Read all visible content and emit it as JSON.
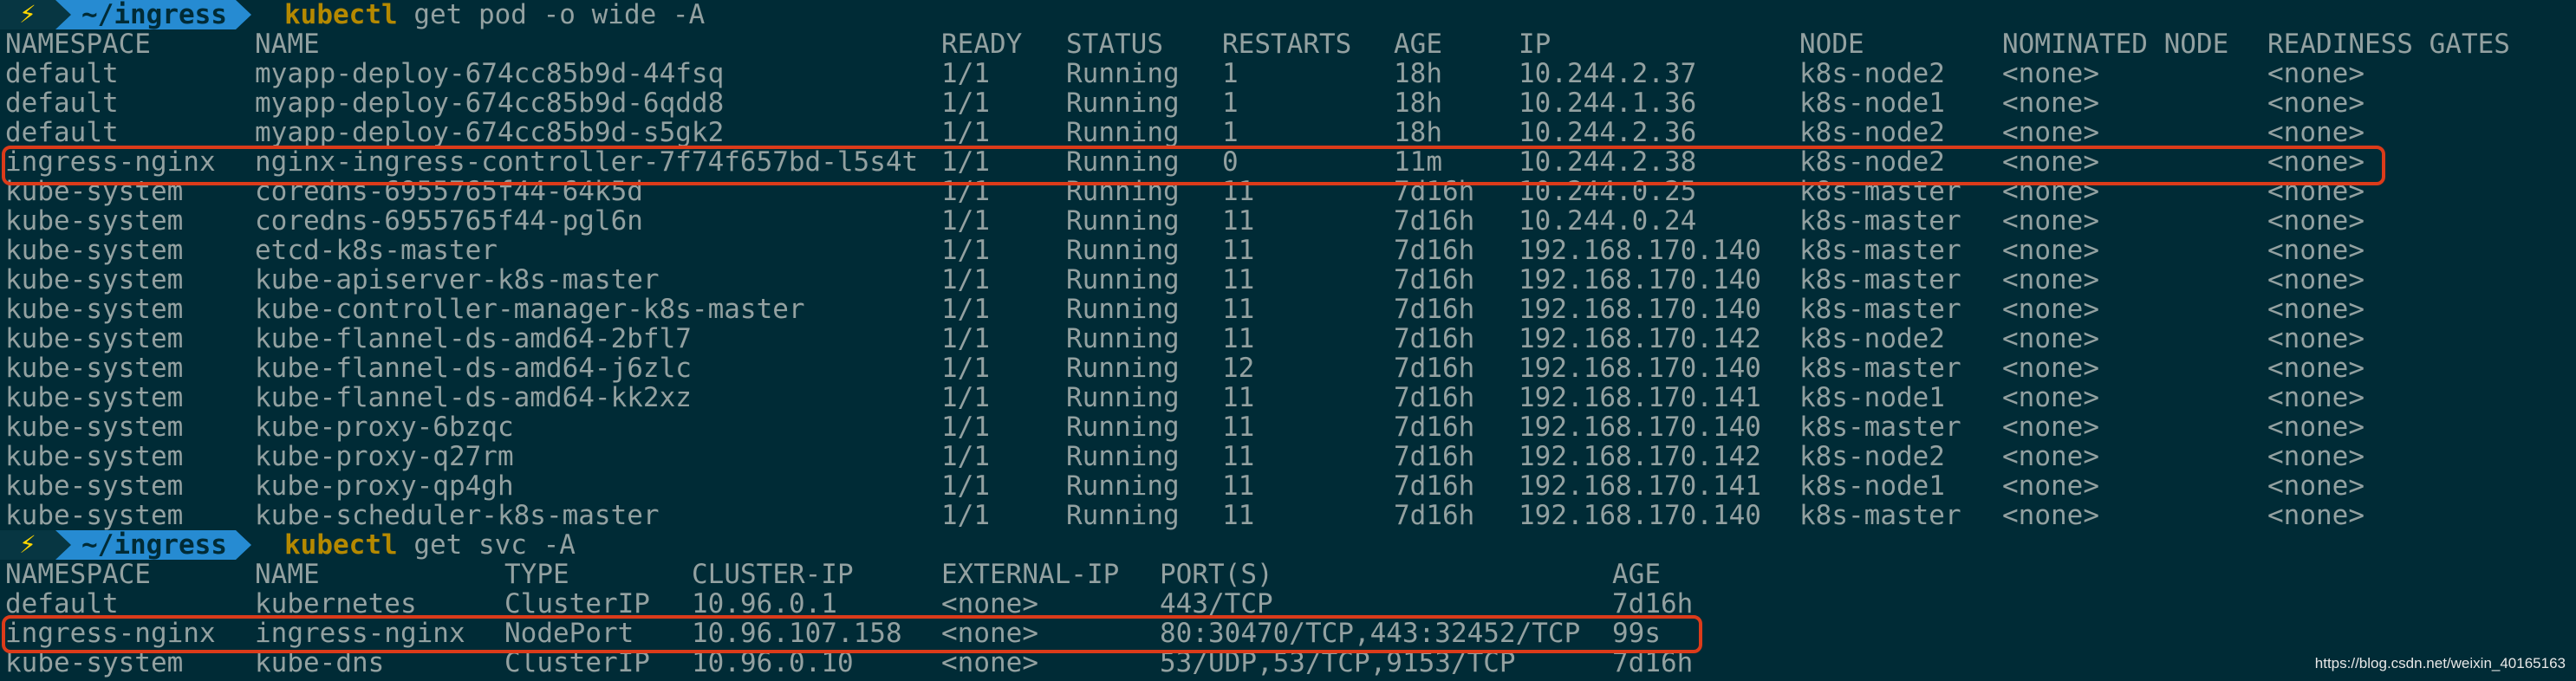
{
  "prompt": {
    "bolt_icon": "⚡",
    "dir": "~/ingress"
  },
  "cmd1": {
    "bin": "kubectl",
    "args": " get pod -o wide -A"
  },
  "pod_headers": [
    "NAMESPACE",
    "NAME",
    "READY",
    "STATUS",
    "RESTARTS",
    "AGE",
    "IP",
    "NODE",
    "NOMINATED NODE",
    "READINESS GATES"
  ],
  "pods": [
    [
      "default",
      "myapp-deploy-674cc85b9d-44fsq",
      "1/1",
      "Running",
      "1",
      "18h",
      "10.244.2.37",
      "k8s-node2",
      "<none>",
      "<none>"
    ],
    [
      "default",
      "myapp-deploy-674cc85b9d-6qdd8",
      "1/1",
      "Running",
      "1",
      "18h",
      "10.244.1.36",
      "k8s-node1",
      "<none>",
      "<none>"
    ],
    [
      "default",
      "myapp-deploy-674cc85b9d-s5gk2",
      "1/1",
      "Running",
      "1",
      "18h",
      "10.244.2.36",
      "k8s-node2",
      "<none>",
      "<none>"
    ],
    [
      "ingress-nginx",
      "nginx-ingress-controller-7f74f657bd-l5s4t",
      "1/1",
      "Running",
      "0",
      "11m",
      "10.244.2.38",
      "k8s-node2",
      "<none>",
      "<none>"
    ],
    [
      "kube-system",
      "coredns-6955765f44-64k5d",
      "1/1",
      "Running",
      "11",
      "7d16h",
      "10.244.0.25",
      "k8s-master",
      "<none>",
      "<none>"
    ],
    [
      "kube-system",
      "coredns-6955765f44-pgl6n",
      "1/1",
      "Running",
      "11",
      "7d16h",
      "10.244.0.24",
      "k8s-master",
      "<none>",
      "<none>"
    ],
    [
      "kube-system",
      "etcd-k8s-master",
      "1/1",
      "Running",
      "11",
      "7d16h",
      "192.168.170.140",
      "k8s-master",
      "<none>",
      "<none>"
    ],
    [
      "kube-system",
      "kube-apiserver-k8s-master",
      "1/1",
      "Running",
      "11",
      "7d16h",
      "192.168.170.140",
      "k8s-master",
      "<none>",
      "<none>"
    ],
    [
      "kube-system",
      "kube-controller-manager-k8s-master",
      "1/1",
      "Running",
      "11",
      "7d16h",
      "192.168.170.140",
      "k8s-master",
      "<none>",
      "<none>"
    ],
    [
      "kube-system",
      "kube-flannel-ds-amd64-2bfl7",
      "1/1",
      "Running",
      "11",
      "7d16h",
      "192.168.170.142",
      "k8s-node2",
      "<none>",
      "<none>"
    ],
    [
      "kube-system",
      "kube-flannel-ds-amd64-j6zlc",
      "1/1",
      "Running",
      "12",
      "7d16h",
      "192.168.170.140",
      "k8s-master",
      "<none>",
      "<none>"
    ],
    [
      "kube-system",
      "kube-flannel-ds-amd64-kk2xz",
      "1/1",
      "Running",
      "11",
      "7d16h",
      "192.168.170.141",
      "k8s-node1",
      "<none>",
      "<none>"
    ],
    [
      "kube-system",
      "kube-proxy-6bzqc",
      "1/1",
      "Running",
      "11",
      "7d16h",
      "192.168.170.140",
      "k8s-master",
      "<none>",
      "<none>"
    ],
    [
      "kube-system",
      "kube-proxy-q27rm",
      "1/1",
      "Running",
      "11",
      "7d16h",
      "192.168.170.142",
      "k8s-node2",
      "<none>",
      "<none>"
    ],
    [
      "kube-system",
      "kube-proxy-qp4gh",
      "1/1",
      "Running",
      "11",
      "7d16h",
      "192.168.170.141",
      "k8s-node1",
      "<none>",
      "<none>"
    ],
    [
      "kube-system",
      "kube-scheduler-k8s-master",
      "1/1",
      "Running",
      "11",
      "7d16h",
      "192.168.170.140",
      "k8s-master",
      "<none>",
      "<none>"
    ]
  ],
  "cmd2": {
    "bin": "kubectl",
    "args": " get svc -A"
  },
  "svc_headers": [
    "NAMESPACE",
    "NAME",
    "TYPE",
    "CLUSTER-IP",
    "EXTERNAL-IP",
    "PORT(S)",
    "AGE"
  ],
  "svcs": [
    [
      "default",
      "kubernetes",
      "ClusterIP",
      "10.96.0.1",
      "<none>",
      "443/TCP",
      "7d16h"
    ],
    [
      "ingress-nginx",
      "ingress-nginx",
      "NodePort",
      "10.96.107.158",
      "<none>",
      "80:30470/TCP,443:32452/TCP",
      "99s"
    ],
    [
      "kube-system",
      "kube-dns",
      "ClusterIP",
      "10.96.0.10",
      "<none>",
      "53/UDP,53/TCP,9153/TCP",
      "7d16h"
    ]
  ],
  "watermark": "https://blog.csdn.net/weixin_40165163",
  "colors": {
    "background": "#002b36",
    "text": "#93a1a1",
    "command": "#b58900",
    "path_segment": "#268bd2",
    "highlight": "#dc3b1a"
  }
}
